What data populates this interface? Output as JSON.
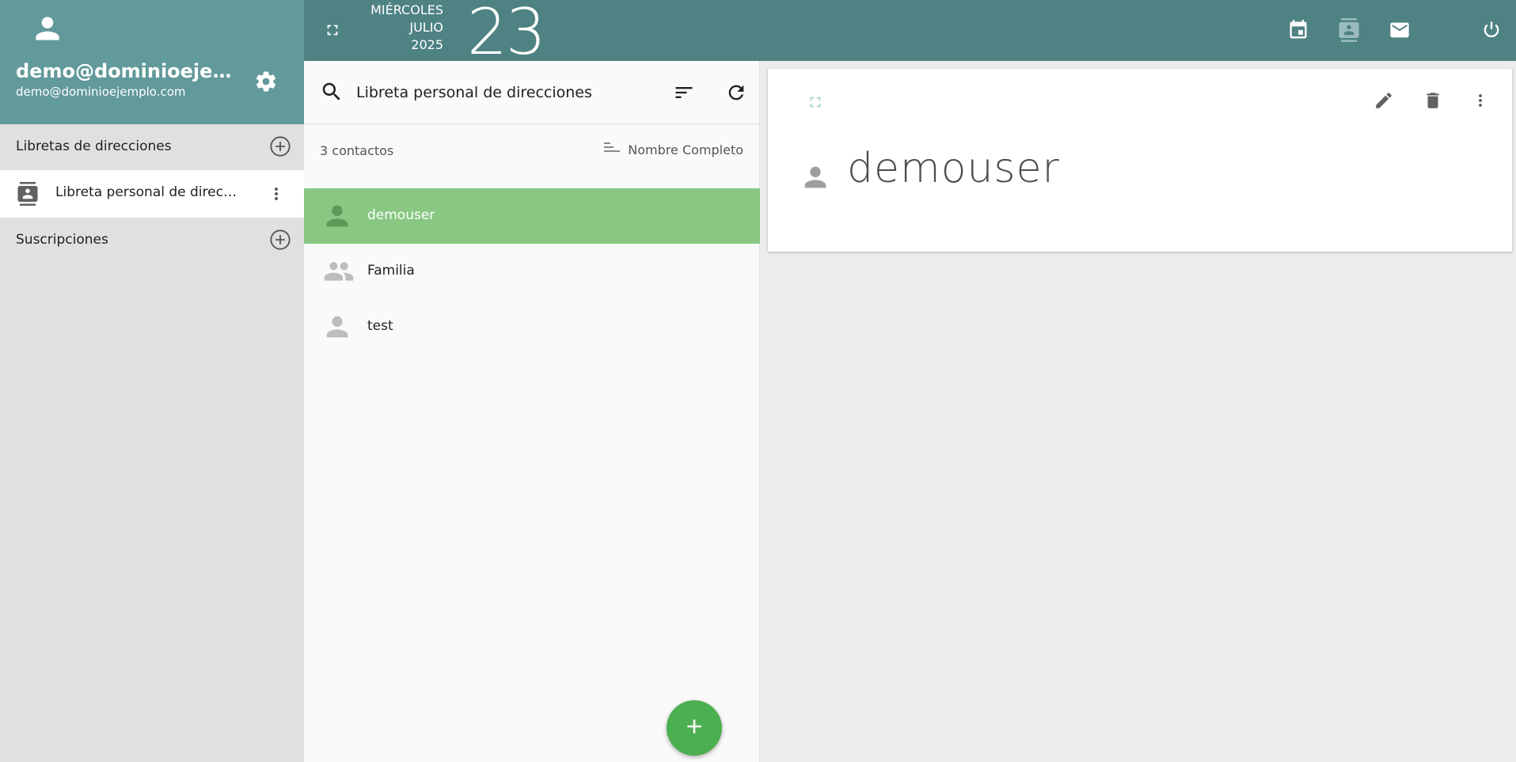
{
  "sidebar": {
    "account_name": "demo@dominioejemplo.com",
    "account_email": "demo@dominioejemplo.com",
    "addressbooks_title": "Libretas de direcciones",
    "addressbook_item": "Libreta personal de direcciones",
    "subscriptions_title": "Suscripciones"
  },
  "topbar": {
    "weekday": "MIÉRCOLES",
    "month": "JULIO",
    "year": "2025",
    "day": "23"
  },
  "list": {
    "search_value": "Libreta personal de direcciones",
    "count": "3 contactos",
    "sort_label": "Nombre Completo",
    "contacts": [
      {
        "name": "demouser",
        "type": "person",
        "selected": true
      },
      {
        "name": "Familia",
        "type": "group",
        "selected": false
      },
      {
        "name": "test",
        "type": "person",
        "selected": false
      }
    ]
  },
  "detail": {
    "name": "demouser"
  },
  "colors": {
    "sidebar_header": "#62999a",
    "topbar": "#4e8283",
    "selected_row": "#88c882",
    "fab": "#4caf50"
  },
  "icons": [
    "person-icon",
    "gear-icon",
    "add-circle-icon",
    "addressbook-icon",
    "more-vert-icon",
    "fullscreen-icon",
    "calendar-icon",
    "contacts-icon",
    "mail-icon",
    "power-icon",
    "search-icon",
    "sort-icon",
    "refresh-icon",
    "sort-lines-icon",
    "group-icon",
    "plus-icon",
    "edit-icon",
    "delete-icon"
  ]
}
